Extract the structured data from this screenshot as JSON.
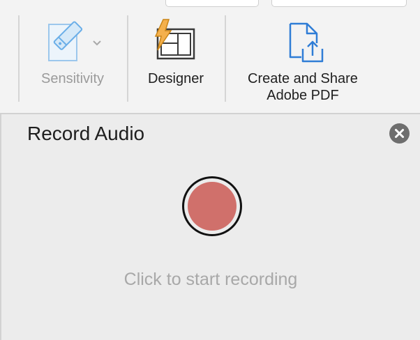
{
  "ribbon": {
    "sensitivity_label": "Sensitivity",
    "designer_label": "Designer",
    "adobe_label_line1": "Create and Share",
    "adobe_label_line2": "Adobe PDF"
  },
  "icons": {
    "sensitivity": "sensitivity-icon",
    "dropdown": "chevron-down-icon",
    "designer": "designer-icon",
    "adobe": "share-pdf-icon",
    "close": "close-icon"
  },
  "panel": {
    "title": "Record Audio",
    "hint": "Click to start recording"
  },
  "colors": {
    "record_fill": "#d0706b",
    "designer_bolt": "#f4b04c",
    "adobe_icon": "#2f7dd6",
    "sensitivity_icon": "#6aaee8"
  }
}
